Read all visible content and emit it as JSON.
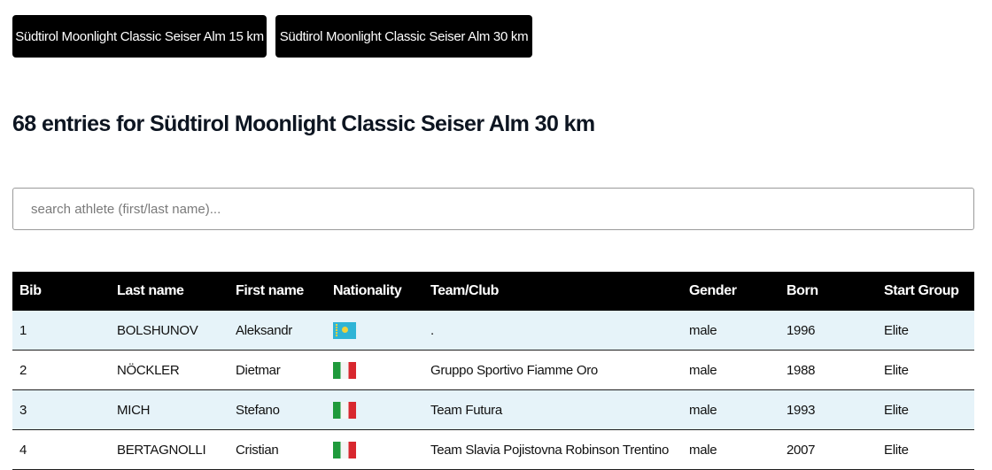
{
  "race_buttons": [
    {
      "label": "Südtirol Moonlight Classic Seiser Alm 15 km"
    },
    {
      "label": "Südtirol Moonlight Classic Seiser Alm 30 km"
    }
  ],
  "heading": "68 entries for Südtirol Moonlight Classic Seiser Alm 30 km",
  "search": {
    "placeholder": "search athlete (first/last name)...",
    "value": ""
  },
  "table": {
    "columns": [
      "Bib",
      "Last name",
      "First name",
      "Nationality",
      "Team/Club",
      "Gender",
      "Born",
      "Start Group"
    ],
    "rows": [
      {
        "bib": "1",
        "last_name": "BOLSHUNOV",
        "first_name": "Aleksandr",
        "nationality_icon": "kazakhstan-flag-icon",
        "team": ".",
        "gender": "male",
        "born": "1996",
        "start_group": "Elite"
      },
      {
        "bib": "2",
        "last_name": "NÖCKLER",
        "first_name": "Dietmar",
        "nationality_icon": "italy-flag-icon",
        "team": "Gruppo Sportivo Fiamme Oro",
        "gender": "male",
        "born": "1988",
        "start_group": "Elite"
      },
      {
        "bib": "3",
        "last_name": "MICH",
        "first_name": "Stefano",
        "nationality_icon": "italy-flag-icon",
        "team": "Team Futura",
        "gender": "male",
        "born": "1993",
        "start_group": "Elite"
      },
      {
        "bib": "4",
        "last_name": "BERTAGNOLLI",
        "first_name": "Cristian",
        "nationality_icon": "italy-flag-icon",
        "team": "Team Slavia Pojistovna Robinson Trentino",
        "gender": "male",
        "born": "2007",
        "start_group": "Elite"
      }
    ]
  },
  "colors": {
    "button_bg": "#000000",
    "header_bg": "#000000",
    "row_alt_bg": "#e6f3f9",
    "italy_green": "#1f9a3c",
    "italy_red": "#d8272e",
    "kazakhstan_blue": "#2fb4d6"
  }
}
